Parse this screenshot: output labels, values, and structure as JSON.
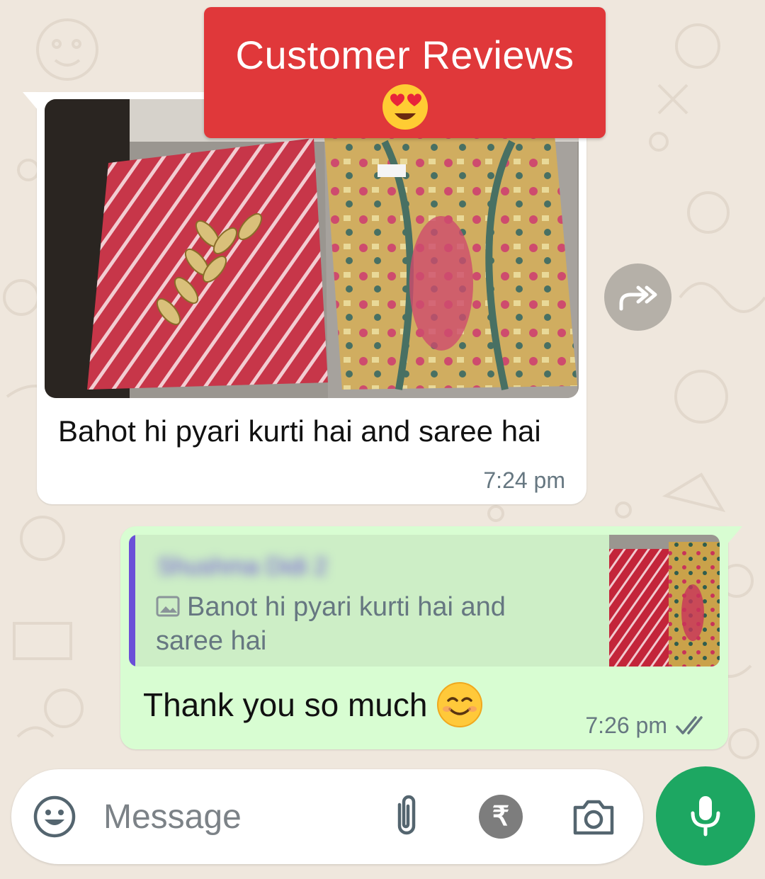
{
  "banner": {
    "title": "Customer Reviews",
    "emoji_icon": "heart-eyes-emoji-icon"
  },
  "incoming": {
    "caption": "Bahot hi pyari kurti hai and saree hai",
    "time": "7:24 pm"
  },
  "outgoing": {
    "quoted_author": "Shushma Didi 2",
    "quoted_text": "Banot hi pyari kurti hai and saree hai",
    "text": "Thank you so much",
    "time": "7:26 pm",
    "status_icon": "double-check-icon"
  },
  "composer": {
    "placeholder": "Message",
    "rupee_symbol": "₹",
    "icons": [
      "emoji-icon",
      "attach-icon",
      "rupee-icon",
      "camera-icon",
      "mic-icon"
    ]
  },
  "colors": {
    "banner": "#e0383a",
    "outgoing_bubble": "#d8fdd2",
    "quote_accent": "#6b4fd8",
    "mic_button": "#1da762"
  }
}
